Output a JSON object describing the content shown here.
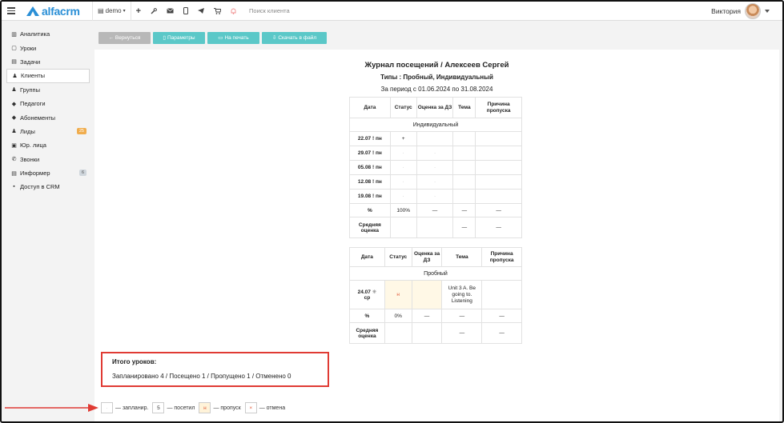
{
  "topbar": {
    "logo_text": "alfacrm",
    "branch": "demo",
    "search_placeholder": "Поиск клиента",
    "user_name": "Виктория"
  },
  "sidebar": {
    "items": [
      {
        "label": "Аналитика",
        "icon": "analytics-icon"
      },
      {
        "label": "Уроки",
        "icon": "calendar-icon"
      },
      {
        "label": "Задачи",
        "icon": "tasks-icon"
      },
      {
        "label": "Клиенты",
        "icon": "user-icon",
        "active": true
      },
      {
        "label": "Группы",
        "icon": "users-icon"
      },
      {
        "label": "Педагоги",
        "icon": "graduation-cap-icon"
      },
      {
        "label": "Абонементы",
        "icon": "tag-icon"
      },
      {
        "label": "Лиды",
        "icon": "user-plus-icon",
        "badge": "25"
      },
      {
        "label": "Юр. лица",
        "icon": "briefcase-icon"
      },
      {
        "label": "Звонки",
        "icon": "phone-icon"
      },
      {
        "label": "Информер",
        "icon": "informer-icon",
        "badge": "6"
      },
      {
        "label": "Доступ в CRM",
        "icon": "lock-icon"
      }
    ]
  },
  "toolbar": {
    "back_label": "← Вернуться",
    "params_label": "Параметры",
    "print_label": "На печать",
    "download_label": "Скачать в файл"
  },
  "report": {
    "title": "Журнал посещений / Алексеев Сергей",
    "types": "Типы : Пробный, Индивидуальный",
    "period": "За период с 01.06.2024 по 31.08.2024"
  },
  "table1": {
    "headers": [
      "Дата",
      "Статус",
      "Оценка за ДЗ",
      "Тема",
      "Причина пропуска"
    ],
    "section": "Индивидуальный",
    "rows": [
      {
        "date": "22.07",
        "flag": "!",
        "day": "пн",
        "status": "+",
        "hw": "",
        "topic": "",
        "reason": ""
      },
      {
        "date": "29.07",
        "flag": "!",
        "day": "пн",
        "status": "·",
        "hw": "·",
        "topic": "",
        "reason": ""
      },
      {
        "date": "05.08",
        "flag": "!",
        "day": "пн",
        "status": "·",
        "hw": "·",
        "topic": "",
        "reason": ""
      },
      {
        "date": "12.08",
        "flag": "!",
        "day": "пн",
        "status": "·",
        "hw": "·",
        "topic": "",
        "reason": ""
      },
      {
        "date": "19.08",
        "flag": "!",
        "day": "пн",
        "status": "·",
        "hw": "·",
        "topic": "",
        "reason": ""
      }
    ],
    "percent_label": "%",
    "percent_value": "100%",
    "dash": "—",
    "avg_label": "Средняя оценка"
  },
  "table2": {
    "headers": [
      "Дата",
      "Статус",
      "Оценка за ДЗ",
      "Тема",
      "Причина пропуска"
    ],
    "section": "Пробный",
    "row": {
      "date": "24.07",
      "day": "ср",
      "status": "н",
      "hw": "",
      "topic": "Unit 3 A. Be going to. Listening",
      "reason": ""
    },
    "percent_label": "%",
    "percent_value": "0%",
    "dash": "—",
    "avg_label": "Средняя оценка"
  },
  "summary": {
    "title": "Итого уроков:",
    "text": "Запланировано 4 / Посещено 1 / Пропущено 1 / Отменено 0"
  },
  "legend": {
    "planned_box": "·",
    "planned_label": "— запланир.",
    "visited_box": "5",
    "visited_label": "— посетил",
    "missed_box": "н",
    "missed_label": "— пропуск",
    "cancel_box": "×",
    "cancel_label": "— отмена"
  },
  "colors": {
    "brand": "#2a8fd6",
    "teal_button": "#5bc8c8",
    "highlight_red": "#e03b34",
    "badge_orange": "#f0ad4e"
  }
}
